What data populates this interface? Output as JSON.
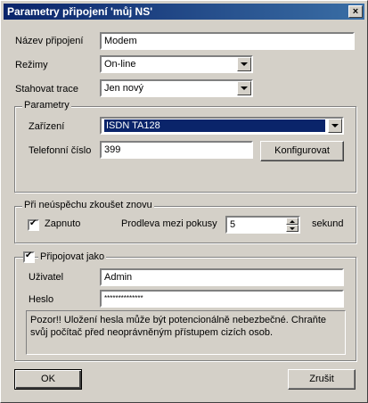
{
  "window": {
    "title": "Parametry připojení 'můj NS'",
    "close_glyph": "×"
  },
  "connection": {
    "name_label": "Název připojení",
    "name_value": "Modem",
    "mode_label": "Režimy",
    "mode_value": "On-line",
    "trace_label": "Stahovat trace",
    "trace_value": "Jen nový"
  },
  "parameters": {
    "legend": "Parametry",
    "device_label": "Zařízení",
    "device_value": "ISDN TA128",
    "phone_label": "Telefonní číslo",
    "phone_value": "399",
    "configure_button": "Konfigurovat"
  },
  "retry": {
    "legend": "Při neúspěchu zkoušet znovu",
    "enabled_label": "Zapnuto",
    "enabled": true,
    "delay_label": "Prodleva mezi pokusy",
    "delay_value": "5",
    "delay_unit": "sekund"
  },
  "login": {
    "legend": "Připojovat jako",
    "enabled": true,
    "user_label": "Uživatel",
    "user_value": "Admin",
    "password_label": "Heslo",
    "password_value": "**************",
    "warning": "Pozor!! Uložení hesla může být potencionálně nebezbečné. Chraňte svůj počítač před neoprávněným přístupem cizích osob."
  },
  "buttons": {
    "ok": "OK",
    "cancel": "Zrušit"
  }
}
